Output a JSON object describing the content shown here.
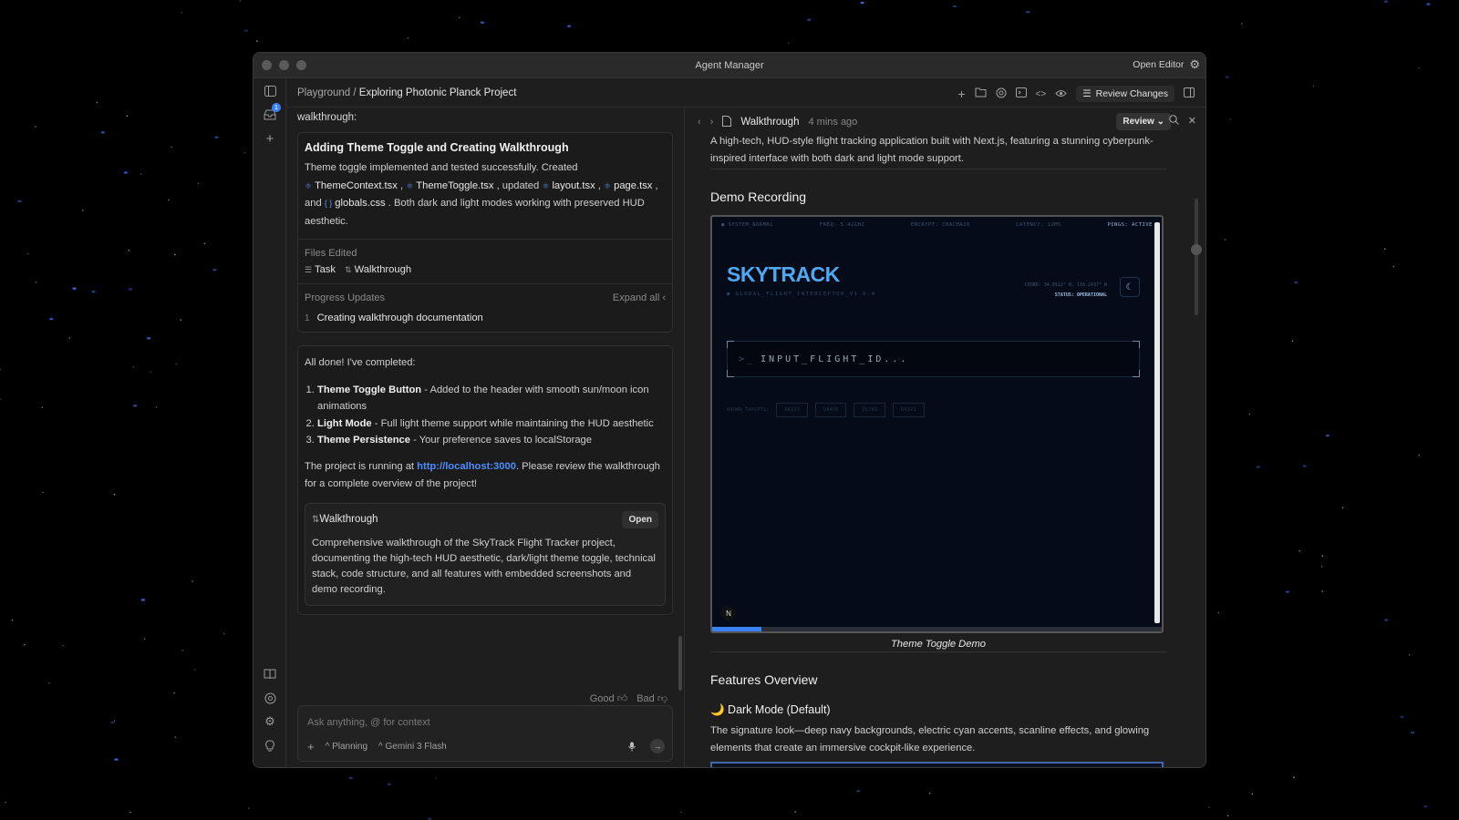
{
  "window": {
    "title": "Agent Manager",
    "open_editor": "Open Editor"
  },
  "rail": {
    "inbox_badge": "1"
  },
  "breadcrumb": {
    "root": "Playground",
    "sep": "/",
    "current": "Exploring Photonic Planck Project"
  },
  "toolbar": {
    "review_changes": "Review Changes"
  },
  "chat": {
    "lead": "walkthrough:",
    "task_card": {
      "title": "Adding Theme Toggle and Creating Walkthrough",
      "t1": "Theme toggle implemented and tested successfully. Created",
      "f1": "ThemeContext.tsx",
      "f2": "ThemeToggle.tsx",
      "t2": ", updated",
      "f3": "layout.tsx",
      "f4": "page.tsx",
      "t3": ", and",
      "f5": "globals.css",
      "t4": ". Both dark and light modes working with preserved HUD aesthetic.",
      "files_edited_label": "Files Edited",
      "file_task": "Task",
      "file_walkthrough": "Walkthrough",
      "progress_label": "Progress Updates",
      "expand_all": "Expand all",
      "progress_num": "1",
      "progress_text": "Creating walkthrough documentation"
    },
    "done_card": {
      "intro": "All done! I've completed:",
      "items": [
        {
          "b": "Theme Toggle Button",
          "t": " - Added to the header with smooth sun/moon icon animations"
        },
        {
          "b": "Light Mode",
          "t": " - Full light theme support while maintaining the HUD aesthetic"
        },
        {
          "b": "Theme Persistence",
          "t": " - Your preference saves to localStorage"
        }
      ],
      "running_pre": "The project is running at ",
      "running_link": "http://localhost:3000",
      "running_post": ". Please review the walkthrough for a complete overview of the project!",
      "artifact_title": "Walkthrough",
      "artifact_open": "Open",
      "artifact_desc": "Comprehensive walkthrough of the SkyTrack Flight Tracker project, documenting the high-tech HUD aesthetic, dark/light theme toggle, technical stack, code structure, and all features with embedded screenshots and demo recording."
    },
    "feedback": {
      "good": "Good",
      "bad": "Bad"
    },
    "composer": {
      "placeholder": "Ask anything, @ for context",
      "mode": "Planning",
      "model": "Gemini 3 Flash"
    }
  },
  "doc": {
    "title": "Walkthrough",
    "time": "4 mins ago",
    "review": "Review",
    "intro": "A high-tech, HUD-style flight tracking application built with Next.js, featuring a stunning cyberpunk-inspired interface with both dark and light mode support.",
    "demo_heading": "Demo Recording",
    "demo": {
      "hud": [
        "SYSTEM_NORMAL",
        "FREQ: 5.42GHZ",
        "ENCRYPT: CHACHA20",
        "LATENCY: 12MS",
        "PINGS: ACTIVE"
      ],
      "logo": "SKYTRACK",
      "logo_sub": "GLOBAL_FLIGHT_INTERCEPTOR_V1.0.4",
      "coords": "COORD: 34.0522° N, 118.2437° W",
      "status": "STATUS: OPERATIONAL",
      "input_prompt": ">_",
      "input_text": "INPUT_FLIGHT_ID...",
      "known": "KNOWN_TARGETS:",
      "chips": [
        "AA123",
        "UA456",
        "DL789",
        "BA321"
      ],
      "n_badge": "N",
      "progress": 0.11
    },
    "caption": "Theme Toggle Demo",
    "features_heading": "Features Overview",
    "dark_mode_title": "🌙 Dark Mode (Default)",
    "dark_mode_desc": "The signature look—deep navy backgrounds, electric cyan accents, scanline effects, and glowing elements that create an immersive cockpit-like experience."
  },
  "colors": {
    "accent": "#4f8cff",
    "logo": "#4fa8f0",
    "window": "#1e1e1e"
  }
}
